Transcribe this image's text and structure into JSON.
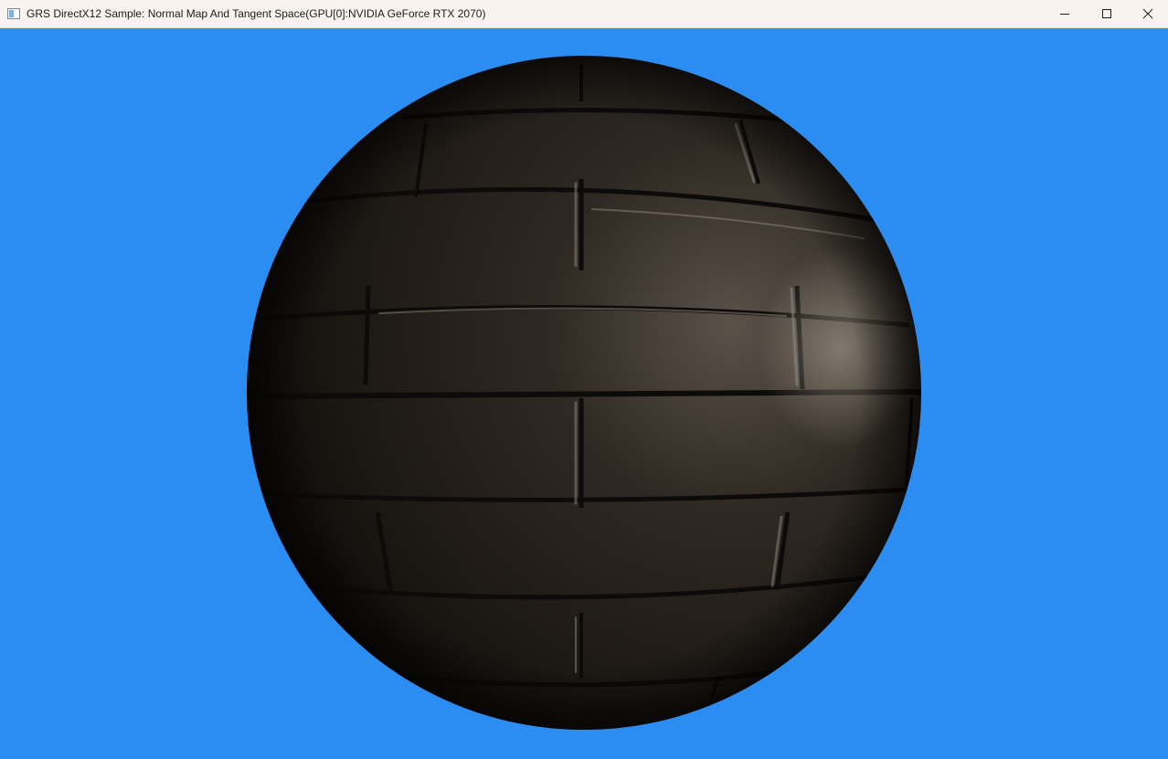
{
  "window": {
    "title": "GRS DirectX12 Sample: Normal Map And Tangent Space(GPU[0]:NVIDIA GeForce RTX 2070)",
    "controls": {
      "minimize_icon": "minimize-icon",
      "maximize_icon": "maximize-icon",
      "close_icon": "close-icon"
    }
  },
  "scene": {
    "background_color": "#2b8cf1",
    "object": "brick-textured sphere",
    "brick_color": "#2a241e",
    "mortar_color": "#0d0b09",
    "highlight_color": "#8a8176"
  }
}
